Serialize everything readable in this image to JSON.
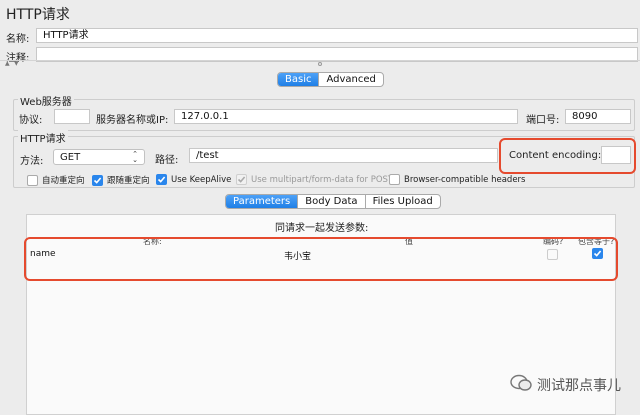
{
  "window": {
    "title": "HTTP请求"
  },
  "name_row": {
    "label": "名称:",
    "value": "HTTP请求"
  },
  "comment_row": {
    "label": "注释:",
    "value": ""
  },
  "tabs": [
    {
      "label": "Basic",
      "active": true
    },
    {
      "label": "Advanced",
      "active": false
    }
  ],
  "web_server": {
    "title": "Web服务器",
    "protocol_label": "协议:",
    "protocol_value": "",
    "host_label": "服务器名称或IP:",
    "host_value": "127.0.0.1",
    "port_label": "端口号:",
    "port_value": "8090"
  },
  "http_request": {
    "title": "HTTP请求",
    "method_label": "方法:",
    "method_value": "GET",
    "path_label": "路径:",
    "path_value": "/test",
    "encoding_label": "Content encoding:",
    "encoding_value": ""
  },
  "options": [
    {
      "label": "自动重定向",
      "checked": false,
      "disabled": false
    },
    {
      "label": "跟随重定向",
      "checked": true,
      "disabled": false
    },
    {
      "label": "Use KeepAlive",
      "checked": true,
      "disabled": false
    },
    {
      "label": "Use multipart/form-data for POST",
      "checked": true,
      "disabled": true
    },
    {
      "label": "Browser-compatible headers",
      "checked": false,
      "disabled": false
    }
  ],
  "subtabs": [
    {
      "label": "Parameters",
      "active": true
    },
    {
      "label": "Body Data",
      "active": false
    },
    {
      "label": "Files Upload",
      "active": false
    }
  ],
  "params": {
    "caption": "同请求一起发送参数:",
    "columns": [
      "名称:",
      "值",
      "编码?",
      "包含等于?"
    ],
    "rows": [
      {
        "name": "name",
        "value": "韦小宝",
        "encode": false,
        "include_equals": true
      }
    ]
  },
  "watermark": {
    "text": "测试那点事儿"
  },
  "colors": {
    "accent": "#2a86ec",
    "highlight": "#e54a2e"
  }
}
